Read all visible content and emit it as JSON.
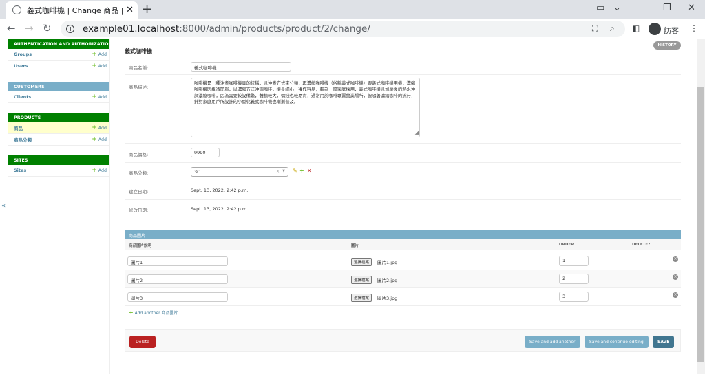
{
  "browser": {
    "tab_title": "義式咖啡機 | Change 商品 | Djan",
    "url_host": "example01.localhost",
    "url_path": ":8000/admin/products/product/2/change/",
    "guest_label": "訪客"
  },
  "sidebar": {
    "modules": [
      {
        "caption": "AUTHENTICATION AND AUTHORIZATION",
        "color": "#008000",
        "items": [
          {
            "label": "Groups",
            "add": "Add"
          },
          {
            "label": "Users",
            "add": "Add"
          }
        ]
      },
      {
        "caption": "CUSTOMERS",
        "color": "#79aec8",
        "items": [
          {
            "label": "Clients",
            "add": "Add"
          }
        ]
      },
      {
        "caption": "PRODUCTS",
        "color": "#008000",
        "items": [
          {
            "label": "商品",
            "add": "Add",
            "current": true
          },
          {
            "label": "商品分類",
            "add": "Add"
          }
        ]
      },
      {
        "caption": "SITES",
        "color": "#008000",
        "items": [
          {
            "label": "Sites",
            "add": "Add"
          }
        ]
      }
    ],
    "toggle": "«"
  },
  "main": {
    "title": "義式咖啡機",
    "history": "HISTORY",
    "fields": {
      "name_label": "商品名稱:",
      "name_value": "義式咖啡機",
      "desc_label": "商品描述:",
      "desc_value": "咖啡機是一種沖煮咖啡機具的統稱，以沖煮方式來分類，再濃縮咖啡機（俗稱義式咖啡機）跟義式咖啡機用機，濃縮咖啡機因構造簡單，以濃縮方法沖調咖啡，機身細小，操作容易，較為一般家庭採用，義式咖啡機以加壓後的熱水沖調濃縮咖啡，因為需要較設備繁，體積較大，價錢也較昂貴，通常用於咖啡專賣營業場所，但隨著濃縮咖啡的流行，針對家庭用戶所設計的小型化義式咖啡機也漸漸普及。",
      "price_label": "商品價格:",
      "price_value": "9990",
      "cat_label": "商品分類:",
      "cat_value": "3C",
      "created_label": "建立日期:",
      "created_value": "Sept. 13, 2022, 2:42 p.m.",
      "modified_label": "修改日期:",
      "modified_value": "Sept. 13, 2022, 2:42 p.m."
    },
    "inline": {
      "caption": "商品圖片",
      "headers": {
        "caption": "商品圖片說明",
        "image": "圖片",
        "order": "ORDER",
        "delete": "DELETE?"
      },
      "rows": [
        {
          "caption": "圖片1",
          "file_btn": "選擇檔案",
          "file": "圖片1.jpg",
          "order": "1"
        },
        {
          "caption": "圖片2",
          "file_btn": "選擇檔案",
          "file": "圖片2.jpg",
          "order": "2"
        },
        {
          "caption": "圖片3",
          "file_btn": "選擇檔案",
          "file": "圖片3.jpg",
          "order": "3"
        }
      ],
      "add_another": "Add another 商品圖片"
    },
    "buttons": {
      "delete": "Delete",
      "save_add": "Save and add another",
      "save_continue": "Save and continue editing",
      "save": "SAVE"
    }
  }
}
